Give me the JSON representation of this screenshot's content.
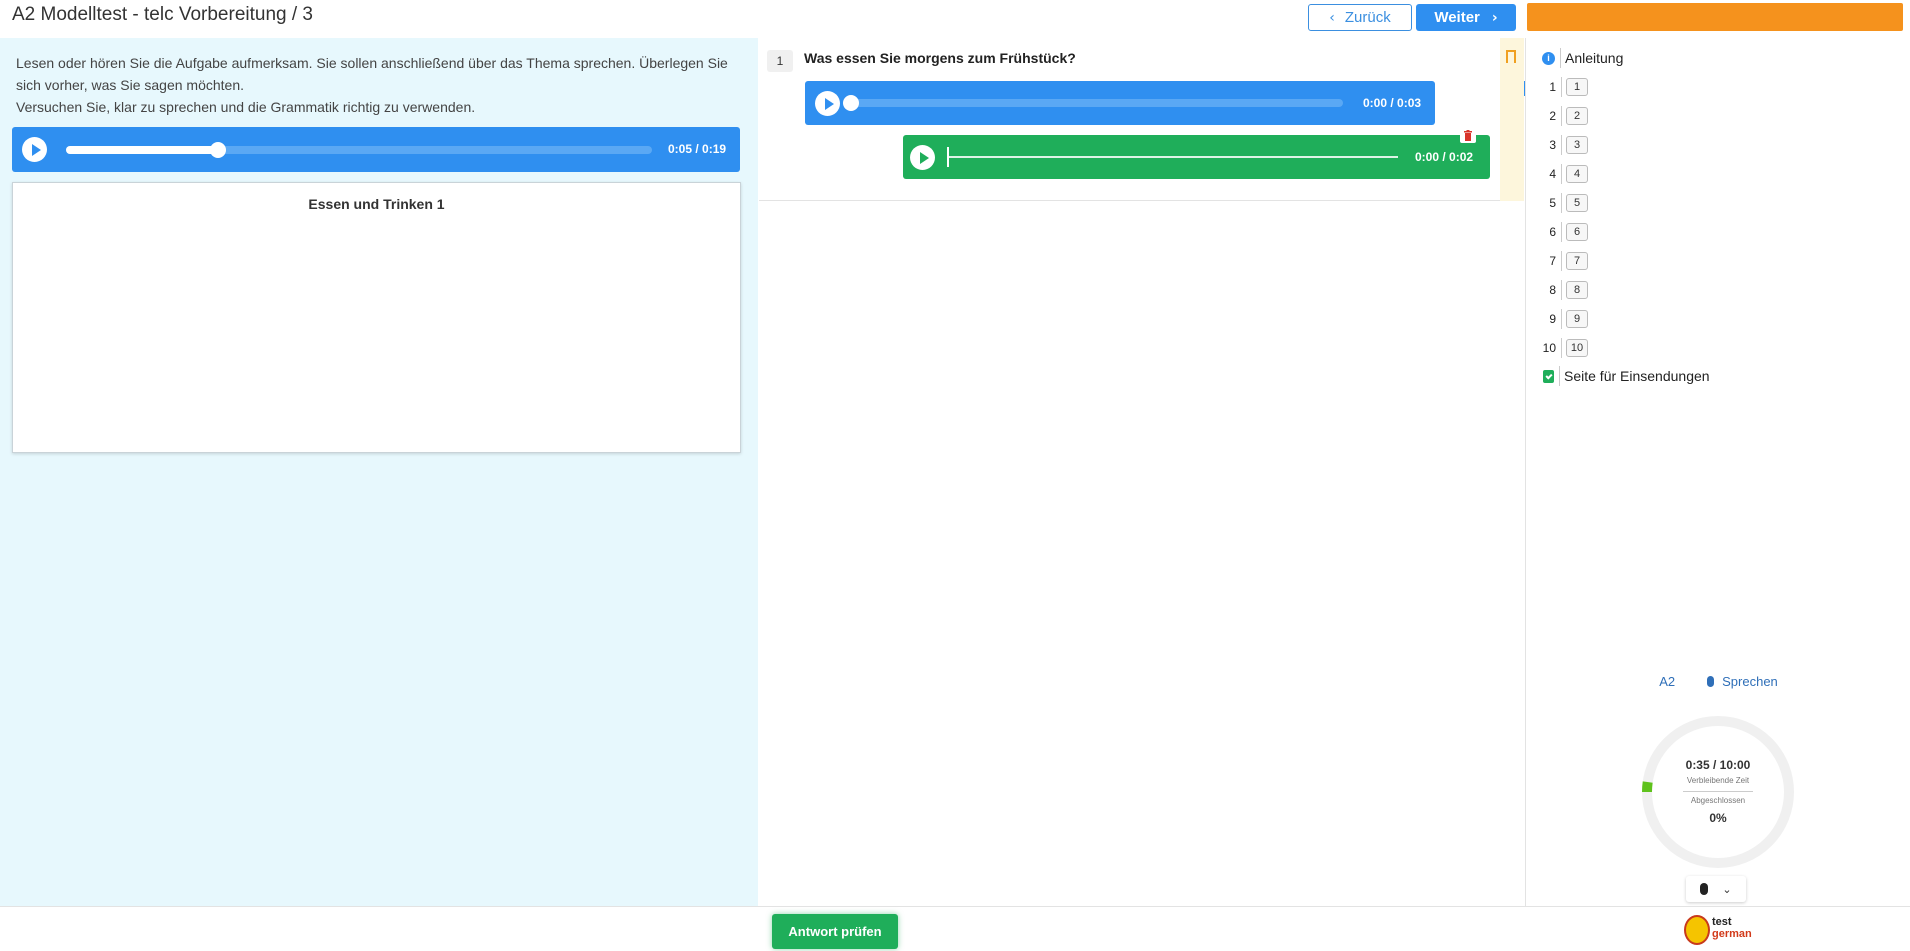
{
  "header": {
    "title": "A2 Modelltest - telc Vorbereitung / 3",
    "back_label": "Zurück",
    "next_label": "Weiter",
    "accent_color": "#f5921d"
  },
  "left": {
    "instruction_1": "Lesen oder hören Sie die Aufgabe aufmerksam. Sie sollen anschließend über das Thema sprechen. Überlegen Sie sich vorher, was Sie sagen möchten.",
    "instruction_2": "Versuchen Sie, klar zu sprechen und die Grammatik richtig zu verwenden.",
    "audio": {
      "time": "0:05 / 0:19",
      "progress": 0.26
    },
    "content_title": "Essen und Trinken 1"
  },
  "question": {
    "number": "1",
    "text": "Was essen Sie morgens zum Frühstück?",
    "audio": {
      "time": "0:00 / 0:03",
      "progress": 0.0
    },
    "recording": {
      "time": "0:00 / 0:02"
    }
  },
  "sidebar": {
    "guide_label": "Anleitung",
    "items": [
      {
        "num": "1",
        "box": "1"
      },
      {
        "num": "2",
        "box": "2"
      },
      {
        "num": "3",
        "box": "3"
      },
      {
        "num": "4",
        "box": "4"
      },
      {
        "num": "5",
        "box": "5"
      },
      {
        "num": "6",
        "box": "6"
      },
      {
        "num": "7",
        "box": "7"
      },
      {
        "num": "8",
        "box": "8"
      },
      {
        "num": "9",
        "box": "9"
      },
      {
        "num": "10",
        "box": "10"
      }
    ],
    "submit_label": "Seite für Einsendungen",
    "level": "A2",
    "skill": "Sprechen",
    "timer": {
      "elapsed": "0:35 / 10:00",
      "remaining_label": "Verbleibende Zeit",
      "completed_label": "Abgeschlossen",
      "completed_value": "0%",
      "elapsed_fraction": 0.06
    }
  },
  "footer": {
    "check_label": "Antwort prüfen",
    "logo_line1": "test",
    "logo_line2": "german"
  },
  "colors": {
    "primary": "#2f8ff0",
    "success": "#1fae5a",
    "left_bg": "#e7f8fd"
  }
}
